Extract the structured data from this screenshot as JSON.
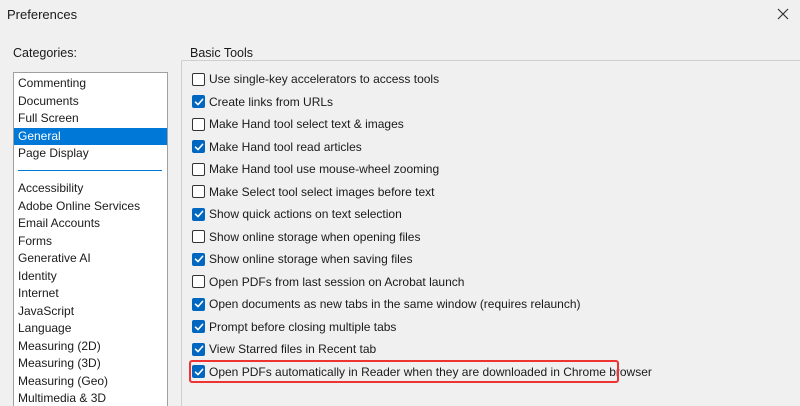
{
  "window": {
    "title": "Preferences"
  },
  "categories": {
    "label": "Categories:",
    "group1": [
      "Commenting",
      "Documents",
      "Full Screen",
      "General",
      "Page Display"
    ],
    "group2": [
      "Accessibility",
      "Adobe Online Services",
      "Email Accounts",
      "Forms",
      "Generative AI",
      "Identity",
      "Internet",
      "JavaScript",
      "Language",
      "Measuring (2D)",
      "Measuring (3D)",
      "Measuring (Geo)",
      "Multimedia & 3D"
    ],
    "selected": "General"
  },
  "basic_tools": {
    "title": "Basic Tools",
    "options": [
      {
        "label": "Use single-key accelerators to access tools",
        "checked": false
      },
      {
        "label": "Create links from URLs",
        "checked": true
      },
      {
        "label": "Make Hand tool select text & images",
        "checked": false
      },
      {
        "label": "Make Hand tool read articles",
        "checked": true
      },
      {
        "label": "Make Hand tool use mouse-wheel zooming",
        "checked": false
      },
      {
        "label": "Make Select tool select images before text",
        "checked": false
      },
      {
        "label": "Show quick actions on text selection",
        "checked": true
      },
      {
        "label": "Show online storage when opening files",
        "checked": false
      },
      {
        "label": "Show online storage when saving files",
        "checked": true
      },
      {
        "label": "Open PDFs from last session on Acrobat launch",
        "checked": false
      },
      {
        "label": "Open documents as new tabs in the same window (requires relaunch)",
        "checked": true
      },
      {
        "label": "Prompt before closing multiple tabs",
        "checked": true
      },
      {
        "label": "View Starred files in Recent tab",
        "checked": true
      },
      {
        "label": "Open PDFs automatically in Reader when they are downloaded in Chrome browser",
        "checked": true
      }
    ]
  },
  "colors": {
    "accent": "#0078d7",
    "checkbox": "#0067c0",
    "highlight": "#e33333"
  }
}
